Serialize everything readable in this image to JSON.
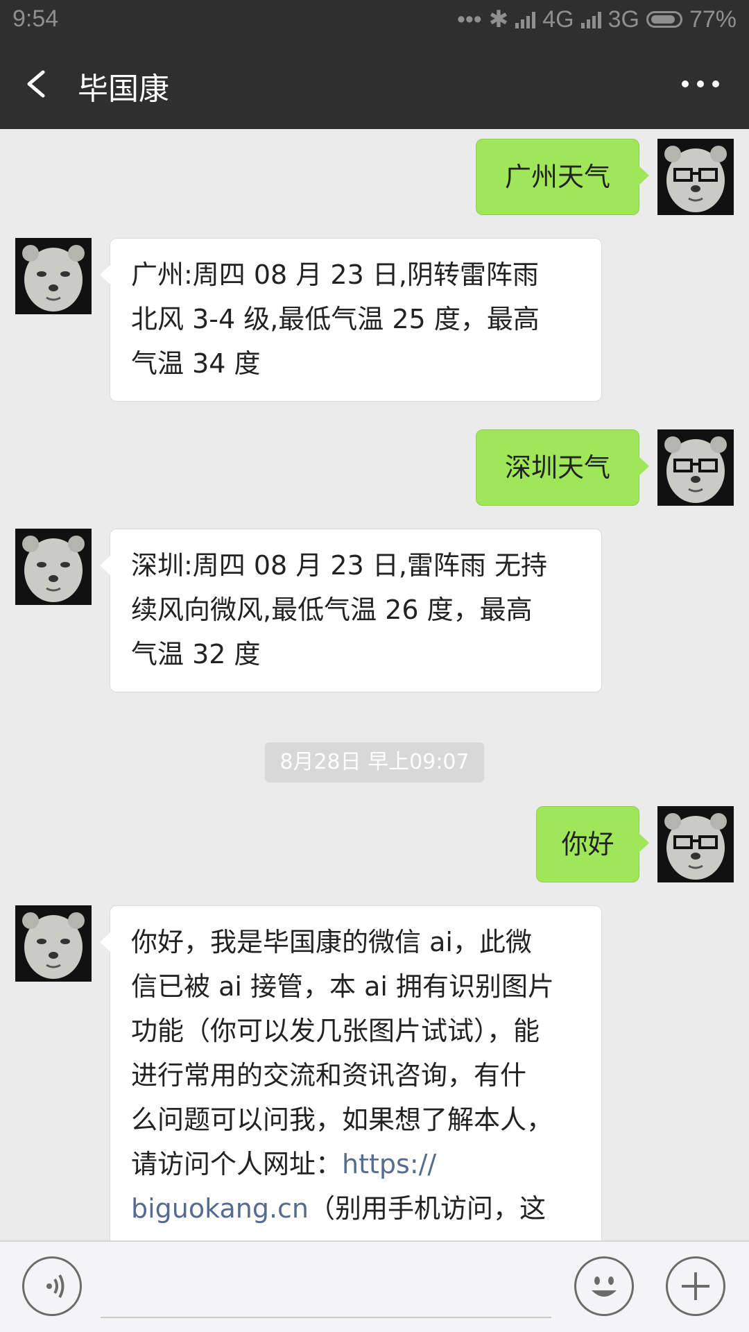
{
  "status_bar": {
    "time": "9:54",
    "network1": "4G",
    "network2": "3G",
    "battery": "77%"
  },
  "nav": {
    "title": "毕国康",
    "back_icon": "chevron-left-icon",
    "more_icon": "more-dots-icon"
  },
  "messages": [
    {
      "side": "out",
      "text": "广州天气"
    },
    {
      "side": "in",
      "lines": [
        "广州:周四 08 月 23 日,阴转雷阵雨",
        "北风 3-4 级,最低气温 25 度，最高",
        "气温 34 度"
      ]
    },
    {
      "side": "out",
      "text": "深圳天气"
    },
    {
      "side": "in",
      "lines": [
        "深圳:周四 08 月 23 日,雷阵雨 无持",
        "续风向微风,最低气温 26 度，最高",
        "气温 32 度"
      ]
    },
    {
      "side": "out",
      "text": "你好"
    },
    {
      "side": "in",
      "lines": [
        "你好，我是毕国康的微信 ai，此微",
        "信已被 ai 接管，本 ai 拥有识别图片",
        "功能（你可以发几张图片试试），能",
        "进行常用的交流和资讯咨询，有什",
        "么问题可以问我，如果想了解本人，"
      ],
      "link_line_prefix": "请访问个人网址：",
      "link_part1": "https://",
      "link_part2": "biguokang.cn",
      "after_link": "（别用手机访问，这"
    }
  ],
  "timestamp": "8月28日 早上09:07",
  "bottom": {
    "voice_icon": "voice-icon",
    "emoji_icon": "emoji-icon",
    "plus_icon": "plus-icon"
  },
  "colors": {
    "header_bg": "#2f2f2f",
    "chat_bg": "#ebebeb",
    "out_bubble": "#9fe658",
    "in_bubble": "#ffffff",
    "link": "#556b8f"
  }
}
